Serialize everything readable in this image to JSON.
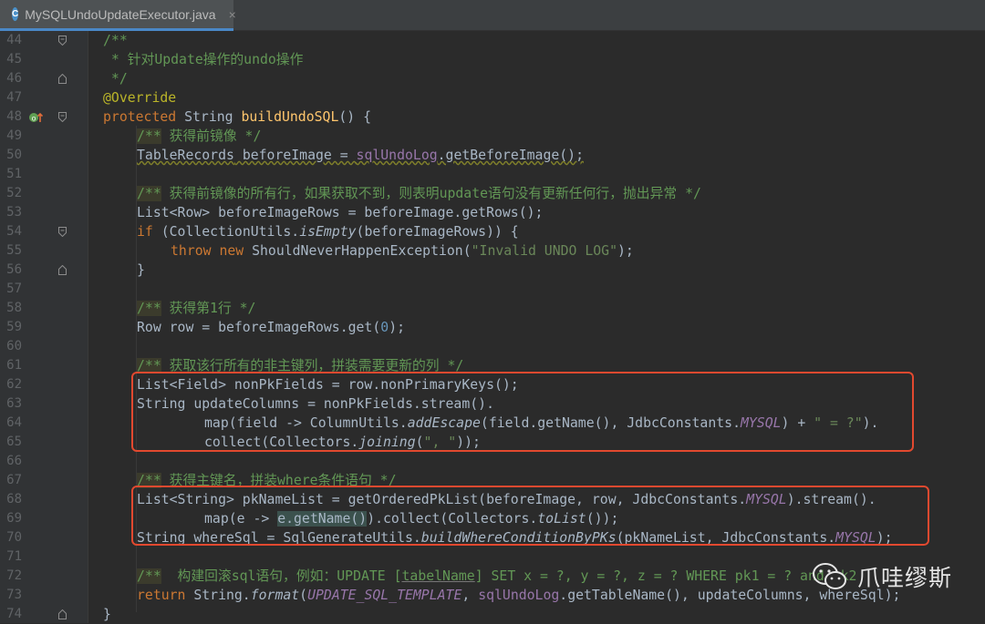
{
  "tab": {
    "icon": "C",
    "filename": "MySQLUndoUpdateExecutor.java",
    "close": "×"
  },
  "watermark": {
    "icon": "wechat-icon",
    "text": "爪哇缪斯"
  },
  "lines": [
    {
      "n": "44"
    },
    {
      "n": "45"
    },
    {
      "n": "46"
    },
    {
      "n": "47"
    },
    {
      "n": "48"
    },
    {
      "n": "49"
    },
    {
      "n": "50"
    },
    {
      "n": "51"
    },
    {
      "n": "52"
    },
    {
      "n": "53"
    },
    {
      "n": "54"
    },
    {
      "n": "55"
    },
    {
      "n": "56"
    },
    {
      "n": "57"
    },
    {
      "n": "58"
    },
    {
      "n": "59"
    },
    {
      "n": "60"
    },
    {
      "n": "61"
    },
    {
      "n": "62"
    },
    {
      "n": "63"
    },
    {
      "n": "64"
    },
    {
      "n": "65"
    },
    {
      "n": "66"
    },
    {
      "n": "67"
    },
    {
      "n": "68"
    },
    {
      "n": "69"
    },
    {
      "n": "70"
    },
    {
      "n": "71"
    },
    {
      "n": "72"
    },
    {
      "n": "73"
    },
    {
      "n": "74"
    }
  ],
  "code": {
    "l44": "/**",
    "l45": " * 针对Update操作的undo操作",
    "l46": " */",
    "l47": "@Override",
    "l48a": "protected ",
    "l48b": "String ",
    "l48c": "buildUndoSQL",
    "l48d": "() {",
    "l49a": "/**",
    "l49b": " 获得前镜像 */",
    "l50a": "TableRecords",
    "l50b": " beforeImage = ",
    "l50c": "sqlUndoLog",
    "l50d": ".getBeforeImage();",
    "l52a": "/**",
    "l52b": " 获得前镜像的所有行，如果获取不到，则表明update语句没有更新任何行，抛出异常 */",
    "l53": "List<Row> beforeImageRows = beforeImage.getRows();",
    "l54a": "if ",
    "l54b": "(CollectionUtils.",
    "l54c": "isEmpty",
    "l54d": "(beforeImageRows)) {",
    "l55a": "throw new ",
    "l55b": "ShouldNeverHappenException(",
    "l55c": "\"Invalid UNDO LOG\"",
    "l55d": ");",
    "l56": "}",
    "l58a": "/**",
    "l58b": " 获得第1行 */",
    "l59a": "Row row = beforeImageRows.get(",
    "l59b": "0",
    "l59c": ");",
    "l61a": "/**",
    "l61b": " 获取该行所有的非主键列，拼装需要更新的列 */",
    "l62": "List<Field> nonPkFields = row.nonPrimaryKeys();",
    "l63": "String updateColumns = nonPkFields.stream().",
    "l64a": "map(field -> ColumnUtils.",
    "l64b": "addEscape",
    "l64c": "(field.getName(), JdbcConstants.",
    "l64d": "MYSQL",
    "l64e": ") + ",
    "l64f": "\" = ?\"",
    "l64g": ").",
    "l65a": "collect(Collectors.",
    "l65b": "joining",
    "l65c": "(",
    "l65d": "\", \"",
    "l65e": "));",
    "l67a": "/**",
    "l67b": " 获得主键名，拼装where条件语句 */",
    "l68a": "List<String> pkNameList = getOrderedPkList(beforeImage, row, JdbcConstants.",
    "l68b": "MYSQL",
    "l68c": ").stream().",
    "l69a": "map(e -> ",
    "l69b": "e.getName()",
    "l69c": ").collect(Collectors.",
    "l69d": "toList",
    "l69e": "());",
    "l70a": "String whereSql = SqlGenerateUtils.",
    "l70b": "buildWhereConditionByPKs",
    "l70c": "(pkNameList, JdbcConstants.",
    "l70d": "MYSQL",
    "l70e": ");",
    "l72a": "/**",
    "l72b": "  构建回滚sql语句，例如：UPDATE [",
    "l72c": "tabelName",
    "l72d": "] SET x = ?, y = ?, z = ? WHERE pk1 = ? and pk2",
    "l73a": "return ",
    "l73b": "String.",
    "l73c": "format",
    "l73d": "(",
    "l73e": "UPDATE_SQL_TEMPLATE",
    "l73f": ", ",
    "l73g": "sqlUndoLog",
    "l73h": ".getTableName(), updateColumns, whereSql);",
    "l74": "}"
  }
}
